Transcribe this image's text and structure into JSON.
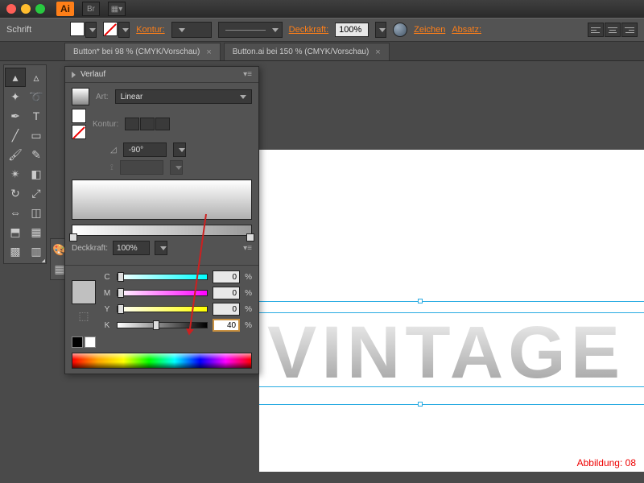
{
  "titlebar": {
    "app_short": "Ai",
    "br_label": "Br"
  },
  "ctrlbar": {
    "schrift": "Schrift",
    "kontur": "Kontur:",
    "deckkraft": "Deckkraft:",
    "opacity_value": "100%",
    "zeichen": "Zeichen",
    "absatz": "Absatz:"
  },
  "tabs": [
    {
      "label": "Button* bei 98 % (CMYK/Vorschau)",
      "active": true
    },
    {
      "label": "Button.ai bei 150 % (CMYK/Vorschau)",
      "active": false
    }
  ],
  "gradient_panel": {
    "title": "Verlauf",
    "art_label": "Art:",
    "art_value": "Linear",
    "kontur_label": "Kontur:",
    "angle_value": "-90°",
    "opacity_label": "Deckkraft:",
    "opacity_value": "100%"
  },
  "color_panel": {
    "channels": [
      {
        "ch": "C",
        "value": "0"
      },
      {
        "ch": "M",
        "value": "0"
      },
      {
        "ch": "Y",
        "value": "0"
      },
      {
        "ch": "K",
        "value": "40"
      }
    ],
    "percent": "%"
  },
  "canvas": {
    "text": "VINTAGE"
  },
  "caption": "Abbildung: 08"
}
